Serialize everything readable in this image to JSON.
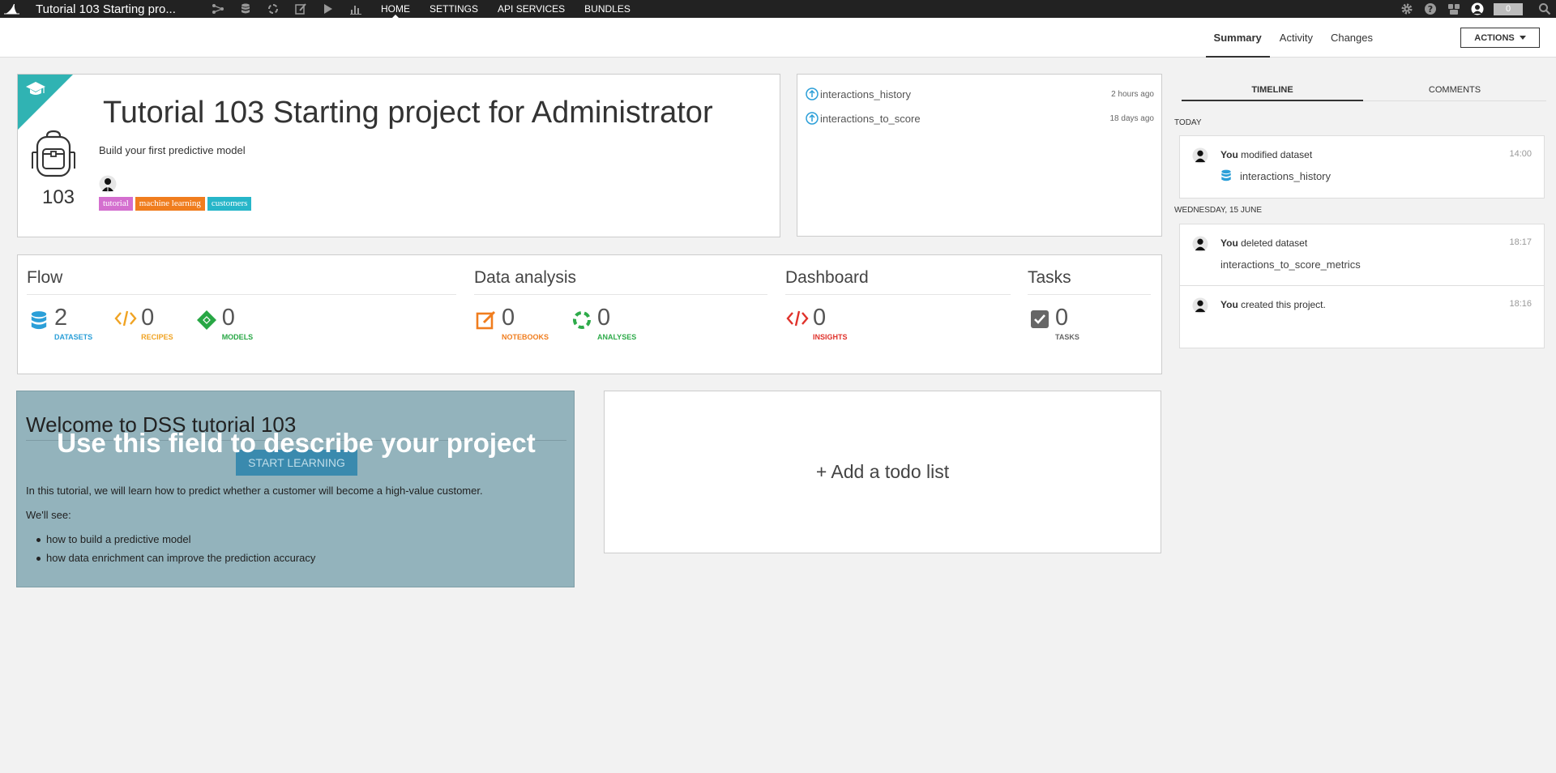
{
  "topbar": {
    "project_title": "Tutorial 103 Starting pro...",
    "nav": [
      "HOME",
      "SETTINGS",
      "API SERVICES",
      "BUNDLES"
    ],
    "counter": "0",
    "icons": [
      "flow-icon",
      "datasets-icon",
      "recipes-icon",
      "notebooks-icon",
      "jobs-icon",
      "dashboards-icon"
    ]
  },
  "subheader": {
    "tabs": [
      "Summary",
      "Activity",
      "Changes"
    ],
    "actions_label": "ACTIONS"
  },
  "project": {
    "number": "103",
    "name": "Tutorial 103 Starting project for Administrator",
    "description": "Build your first predictive model",
    "tags": [
      {
        "label": "tutorial",
        "color": "#d46fcf"
      },
      {
        "label": "machine learning",
        "color": "#f07d1e"
      },
      {
        "label": "customers",
        "color": "#27b6c9"
      }
    ]
  },
  "recent": [
    {
      "name": "interactions_history",
      "time": "2 hours ago"
    },
    {
      "name": "interactions_to_score",
      "time": "18 days ago"
    }
  ],
  "stats": {
    "flow": {
      "title": "Flow",
      "items": [
        {
          "value": "2",
          "label": "DATASETS",
          "color": "#2b9fd8"
        },
        {
          "value": "0",
          "label": "RECIPES",
          "color": "#f0a323"
        },
        {
          "value": "0",
          "label": "MODELS",
          "color": "#28a745"
        }
      ]
    },
    "analysis": {
      "title": "Data analysis",
      "items": [
        {
          "value": "0",
          "label": "NOTEBOOKS",
          "color": "#f07d1e"
        },
        {
          "value": "0",
          "label": "ANALYSES",
          "color": "#2eab4a"
        }
      ]
    },
    "dashboard": {
      "title": "Dashboard",
      "items": [
        {
          "value": "0",
          "label": "INSIGHTS",
          "color": "#e0322b"
        }
      ]
    },
    "tasks": {
      "title": "Tasks",
      "items": [
        {
          "value": "0",
          "label": "TASKS",
          "color": "#666666"
        }
      ]
    }
  },
  "welcome": {
    "title": "Welcome to DSS tutorial 103",
    "overlay": "Use this field to describe your project",
    "button": "START LEARNING",
    "para1": "In this tutorial, we will learn how to predict whether a customer will become a high-value customer.",
    "para2": "We'll see:",
    "bullets": [
      "how to build a predictive model",
      "how data enrichment can improve the prediction accuracy"
    ]
  },
  "todo": {
    "label": "+ Add a todo list"
  },
  "timeline": {
    "tabs": [
      "TIMELINE",
      "COMMENTS"
    ],
    "groups": [
      {
        "date": "TODAY",
        "entries": [
          {
            "who": "You",
            "action": " modified dataset",
            "time": "14:00",
            "object": "interactions_history"
          }
        ]
      },
      {
        "date": "WEDNESDAY, 15 JUNE",
        "entries": [
          {
            "who": "You",
            "action": " deleted dataset",
            "time": "18:17",
            "object": "interactions_to_score_metrics"
          },
          {
            "who": "You",
            "action": " created this project.",
            "time": "18:16",
            "object": ""
          }
        ]
      }
    ]
  }
}
